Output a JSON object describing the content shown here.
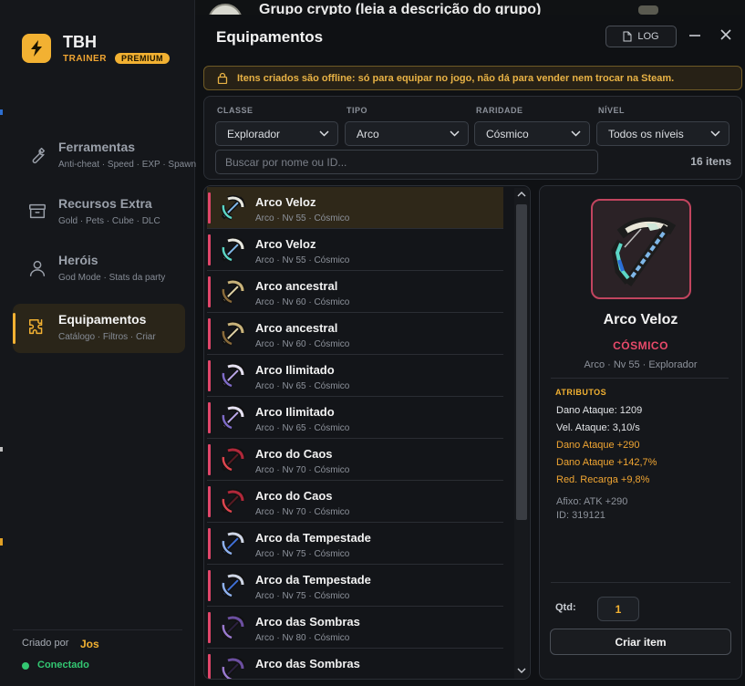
{
  "background_window": {
    "title": "Grupo crypto (leia a descrição do grupo)"
  },
  "sidebar": {
    "brand": {
      "name": "TBH",
      "subtitle": "TRAINER",
      "badge": "PREMIUM"
    },
    "items": [
      {
        "title": "Ferramentas",
        "desc": "Anti-cheat · Speed · EXP · Spawn",
        "icon": "wrench-icon",
        "active": false
      },
      {
        "title": "Recursos Extra",
        "desc": "Gold · Pets · Cube · DLC",
        "icon": "box-icon",
        "active": false
      },
      {
        "title": "Heróis",
        "desc": "God Mode · Stats da party",
        "icon": "user-icon",
        "active": false
      },
      {
        "title": "Equipamentos",
        "desc": "Catálogo · Filtros · Criar",
        "icon": "puzzle-icon",
        "active": true
      }
    ],
    "footer": {
      "created_label": "Criado por",
      "created_user": "Jos",
      "status": "Conectado"
    }
  },
  "header": {
    "title": "Equipamentos",
    "log_label": "LOG"
  },
  "notice": {
    "text": "Itens criados são offline: só para equipar no jogo, não dá para vender nem trocar na Steam."
  },
  "filters": {
    "classe": {
      "label": "CLASSE",
      "value": "Explorador"
    },
    "tipo": {
      "label": "TIPO",
      "value": "Arco"
    },
    "raridade": {
      "label": "RARIDADE",
      "value": "Cósmico"
    },
    "nivel": {
      "label": "NÍVEL",
      "value": "Todos os níveis"
    },
    "search_placeholder": "Buscar por nome ou ID...",
    "count": "16 itens"
  },
  "items": [
    {
      "name": "Arco Veloz",
      "meta": "Arco · Nv 55 · Cósmico",
      "icon": "swift-bow-icon",
      "selected": true
    },
    {
      "name": "Arco Veloz",
      "meta": "Arco · Nv 55 · Cósmico",
      "icon": "swift-bow-icon",
      "selected": false
    },
    {
      "name": "Arco ancestral",
      "meta": "Arco · Nv 60 · Cósmico",
      "icon": "ancestral-bow-icon",
      "selected": false
    },
    {
      "name": "Arco ancestral",
      "meta": "Arco · Nv 60 · Cósmico",
      "icon": "ancestral-bow-icon",
      "selected": false
    },
    {
      "name": "Arco Ilimitado",
      "meta": "Arco · Nv 65 · Cósmico",
      "icon": "unlimited-bow-icon",
      "selected": false
    },
    {
      "name": "Arco Ilimitado",
      "meta": "Arco · Nv 65 · Cósmico",
      "icon": "unlimited-bow-icon",
      "selected": false
    },
    {
      "name": "Arco do Caos",
      "meta": "Arco · Nv 70 · Cósmico",
      "icon": "chaos-bow-icon",
      "selected": false
    },
    {
      "name": "Arco do Caos",
      "meta": "Arco · Nv 70 · Cósmico",
      "icon": "chaos-bow-icon",
      "selected": false
    },
    {
      "name": "Arco da Tempestade",
      "meta": "Arco · Nv 75 · Cósmico",
      "icon": "storm-bow-icon",
      "selected": false
    },
    {
      "name": "Arco da Tempestade",
      "meta": "Arco · Nv 75 · Cósmico",
      "icon": "storm-bow-icon",
      "selected": false
    },
    {
      "name": "Arco das Sombras",
      "meta": "Arco · Nv 80 · Cósmico",
      "icon": "shadow-bow-icon",
      "selected": false
    },
    {
      "name": "Arco das Sombras",
      "meta": "",
      "icon": "shadow-bow-icon",
      "selected": false
    }
  ],
  "detail": {
    "name": "Arco Veloz",
    "rarity": "CÓSMICO",
    "meta": "Arco · Nv 55 · Explorador",
    "attributes_title": "ATRIBUTOS",
    "base_stats": [
      "Dano Ataque: 1209",
      "Vel. Ataque: 3,10/s"
    ],
    "bonus_stats": [
      "Dano Ataque +290",
      "Dano Ataque +142,7%",
      "Red. Recarga +9,8%"
    ],
    "info": [
      "Afixo: ATK +290",
      "ID: 319121"
    ],
    "qty_label": "Qtd:",
    "qty_value": "1",
    "create_label": "Criar item"
  },
  "colors": {
    "accent": "#f2b132",
    "rarity_cosmic": "#e84a6a",
    "online": "#33c772"
  }
}
